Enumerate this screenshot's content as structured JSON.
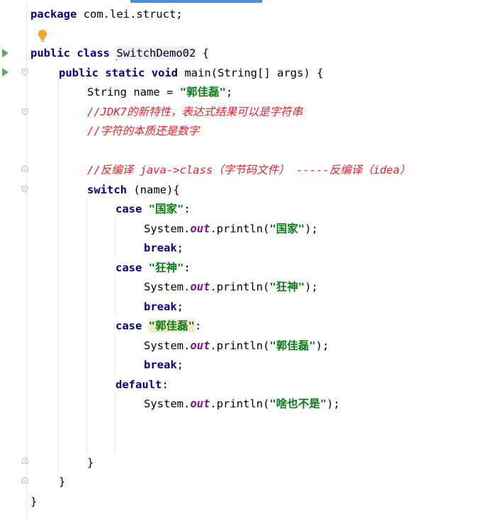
{
  "editor": {
    "lines": {
      "l1": {
        "kw": "package",
        "rest": " com.lei.struct;"
      },
      "l3": {
        "kw1": "public",
        "kw2": "class",
        "classname": "SwitchDemo02",
        "rest": " {"
      },
      "l4": {
        "kw1": "public",
        "kw2": "static",
        "kw3": "void",
        "rest": " main(String[] args) {"
      },
      "l5": {
        "a": "String name = ",
        "str": "\"郭佳磊\"",
        "b": ";"
      },
      "l6": {
        "cmt": "//JDK7的新特性，表达式结果可以是字符串"
      },
      "l7": {
        "cmt": "//字符的本质还是数字"
      },
      "l9": {
        "cmt": "//反编译 java->class（字节码文件） -----反编译（idea）"
      },
      "l10": {
        "kw": "switch",
        "rest": " (name){"
      },
      "l11": {
        "kw": "case",
        "str": "\"国家\"",
        "rest": ":"
      },
      "l12": {
        "a": "System.",
        "field": "out",
        "b": ".println(",
        "str": "\"国家\"",
        "c": ");"
      },
      "l13": {
        "kw": "break",
        "rest": ";"
      },
      "l14": {
        "kw": "case",
        "str": "\"狂神\"",
        "rest": ":"
      },
      "l15": {
        "a": "System.",
        "field": "out",
        "b": ".println(",
        "str": "\"狂神\"",
        "c": ");"
      },
      "l16": {
        "kw": "break",
        "rest": ";"
      },
      "l17": {
        "kw": "case",
        "str": "\"郭佳磊\"",
        "rest": ":"
      },
      "l18": {
        "a": "System.",
        "field": "out",
        "b": ".println(",
        "str": "\"郭佳磊\"",
        "c": ");"
      },
      "l19": {
        "kw": "break",
        "rest": ";"
      },
      "l20": {
        "kw": "default",
        "rest": ":"
      },
      "l21": {
        "a": "System.",
        "field": "out",
        "b": ".println(",
        "str": "\"啥也不是\"",
        "c": ");"
      },
      "l25": {
        "rest": "}"
      },
      "l26": {
        "rest": "}"
      },
      "l27": {
        "rest": "}"
      }
    },
    "icons": {
      "run_gutter": "run-triangle-icon",
      "fold": "fold-marker-icon",
      "intention": "lightbulb-icon"
    },
    "colors": {
      "keyword": "#000080",
      "string": "#067d17",
      "comment": "#e8202a",
      "field": "#871094",
      "run_icon": "#59a869",
      "bulb": "#f5a623"
    }
  }
}
